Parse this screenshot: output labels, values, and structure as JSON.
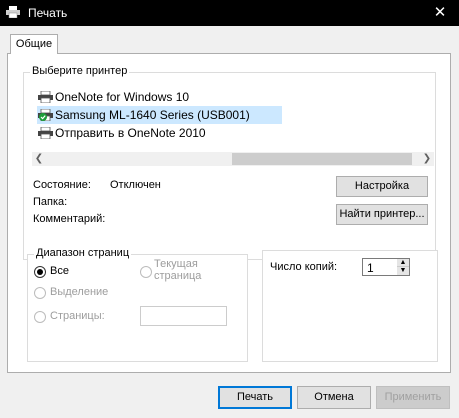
{
  "window": {
    "title": "Печать",
    "close_label": "✕"
  },
  "tabs": [
    {
      "label": "Общие"
    }
  ],
  "printer_group": {
    "title": "Выберите принтер",
    "printers": [
      {
        "name": "OneNote for Windows 10",
        "icon": "printer-icon"
      },
      {
        "name": "Samsung ML-1640 Series (USB001)",
        "icon": "printer-default-icon",
        "selected": true
      },
      {
        "name": "Отправить в OneNote 2010",
        "icon": "printer-icon"
      }
    ],
    "status_label": "Состояние:",
    "status_value": "Отключен",
    "folder_label": "Папка:",
    "comment_label": "Комментарий:",
    "settings_button": "Настройка",
    "find_button": "Найти принтер..."
  },
  "range_group": {
    "title": "Диапазон страниц",
    "all": "Все",
    "current_page_line1": "Текущая",
    "current_page_line2": "страница",
    "selection": "Выделение",
    "pages": "Страницы:",
    "selected_option": "all"
  },
  "copies_group": {
    "label": "Число копий:",
    "value": "1"
  },
  "footer": {
    "print_button": "Печать",
    "cancel_button": "Отмена",
    "apply_button": "Применить"
  },
  "colors": {
    "titlebar": "#000000",
    "selection": "#cce8ff",
    "default_button_border": "#0078d7"
  }
}
